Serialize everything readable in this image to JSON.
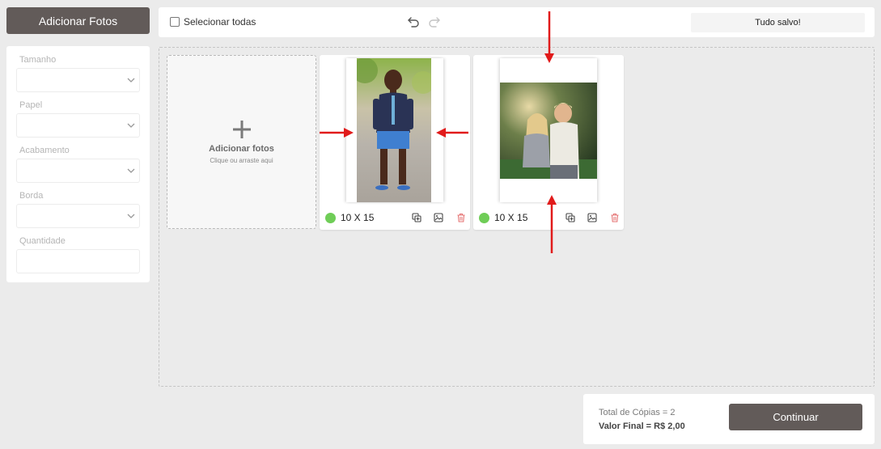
{
  "sidebar": {
    "add_photos_label": "Adicionar Fotos",
    "fields": [
      {
        "label": "Tamanho",
        "value": ""
      },
      {
        "label": "Papel",
        "value": ""
      },
      {
        "label": "Acabamento",
        "value": ""
      },
      {
        "label": "Borda",
        "value": ""
      },
      {
        "label": "Quantidade",
        "value": ""
      }
    ]
  },
  "toolbar": {
    "select_all_label": "Selecionar todas",
    "status": "Tudo salvo!",
    "icons": [
      "undo-icon",
      "redo-icon"
    ]
  },
  "dropzone": {
    "title": "Adicionar fotos",
    "subtitle": "Clique ou arraste aqui",
    "icon": "plus-icon"
  },
  "photos": [
    {
      "size": "10 X 15",
      "status_color": "#6fcd57",
      "subject": "boy-standing-portrait",
      "actions": [
        "duplicate-icon",
        "image-edit-icon",
        "trash-icon"
      ]
    },
    {
      "size": "10 X 15",
      "status_color": "#6fcd57",
      "subject": "two-children-landscape",
      "actions": [
        "duplicate-icon",
        "image-edit-icon",
        "trash-icon"
      ]
    }
  ],
  "summary": {
    "total_copies": "Total de Cópias = 2",
    "final_value": "Valor Final = R$ 2,00",
    "continue_label": "Continuar"
  },
  "colors": {
    "primary_button": "#625b59",
    "annotation_arrow": "#e11b1b",
    "delete_icon": "#e57373"
  }
}
